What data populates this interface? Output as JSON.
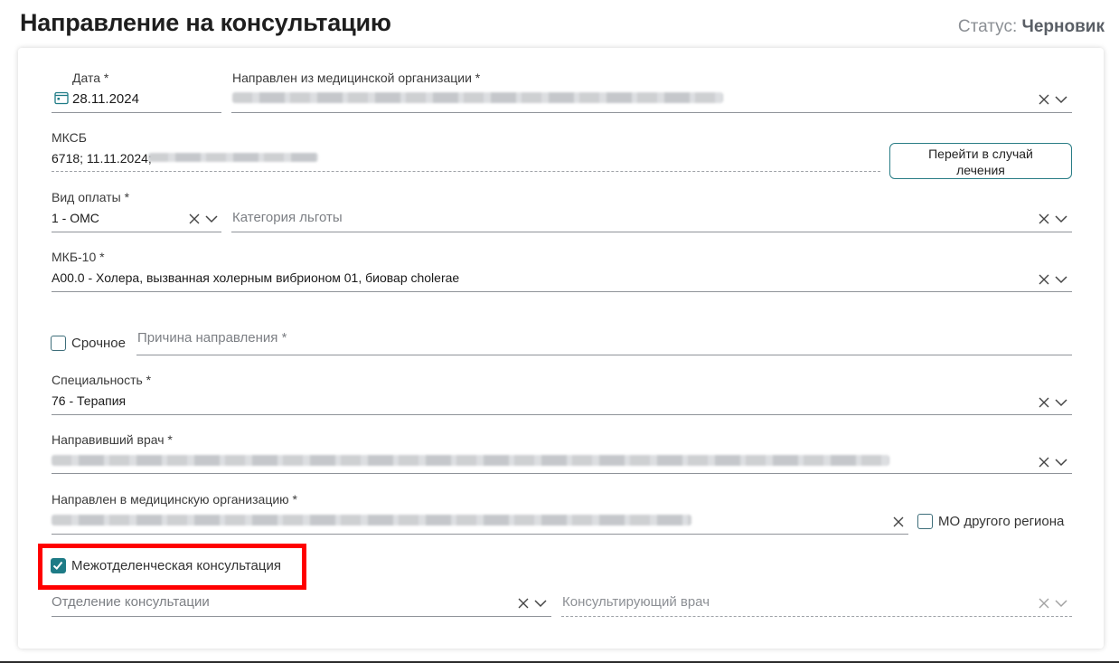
{
  "header": {
    "title": "Направление на консультацию",
    "status_label": "Статус:",
    "status_value": "Черновик"
  },
  "form": {
    "date": {
      "label": "Дата *",
      "value": "28.11.2024"
    },
    "from_org": {
      "label": "Направлен из медицинской организации *"
    },
    "mksb": {
      "label": "МКСБ",
      "value_prefix": "6718; 11.11.2024;"
    },
    "goto_case_button": {
      "line1": "Перейти в случай",
      "line2": "лечения"
    },
    "payment": {
      "label": "Вид оплаты *",
      "value": "1 - ОМС"
    },
    "benefit": {
      "placeholder": "Категория льготы"
    },
    "mkb": {
      "label": "МКБ-10 *",
      "value": "A00.0 - Холера, вызванная холерным вибрионом 01, биовар cholerae"
    },
    "urgent": {
      "label": "Срочное",
      "checked": false
    },
    "reason": {
      "placeholder": "Причина направления *"
    },
    "specialty": {
      "label": "Специальность *",
      "value": "76 - Терапия"
    },
    "doctor": {
      "label": "Направивший врач *"
    },
    "to_org": {
      "label": "Направлен в медицинскую организацию *"
    },
    "other_region": {
      "label": "МО другого региона",
      "checked": false
    },
    "interdept": {
      "label": "Межотделенческая консультация",
      "checked": true
    },
    "department": {
      "placeholder": "Отделение консультации"
    },
    "consultant": {
      "placeholder": "Консультирующий врач"
    }
  },
  "colors": {
    "accent": "#1e7b86",
    "highlight": "#ff0000"
  }
}
